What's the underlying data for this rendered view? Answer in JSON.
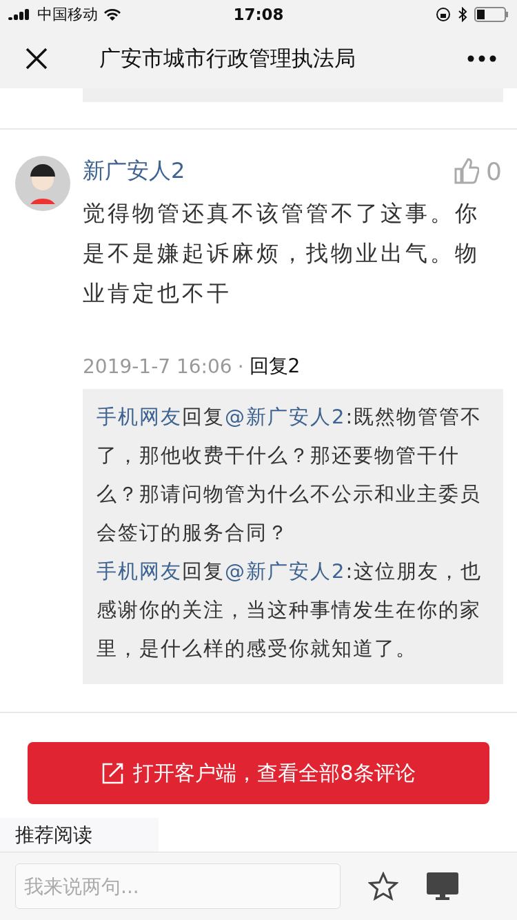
{
  "status_bar": {
    "carrier": "中国移动",
    "time": "17:08"
  },
  "nav": {
    "title": "广安市城市行政管理执法局"
  },
  "comment": {
    "author": "新广安人2",
    "likes": "0",
    "text": "觉得物管还真不该管管不了这事。你是不是嫌起诉麻烦，找物业出气。物业肯定也不干",
    "time": "2019-1-7 16:06",
    "separator": "·",
    "reply_link": "回复2",
    "replies": [
      {
        "author": "手机网友",
        "verb": "回复",
        "mention": "@新广安人2",
        "text": ":既然物管管不了，那他收费干什么？那还要物管干什么？那请问物管为什么不公示和业主委员会签订的服务合同？"
      },
      {
        "author": "手机网友",
        "verb": "回复",
        "mention": "@新广安人2",
        "text": ":这位朋友，也感谢你的关注，当这种事情发生在你的家里，是什么样的感受你就知道了。"
      }
    ]
  },
  "open_app_button": "打开客户端，查看全部8条评论",
  "section_title": "推荐阅读",
  "bottom_bar": {
    "placeholder": "我来说两句..."
  }
}
